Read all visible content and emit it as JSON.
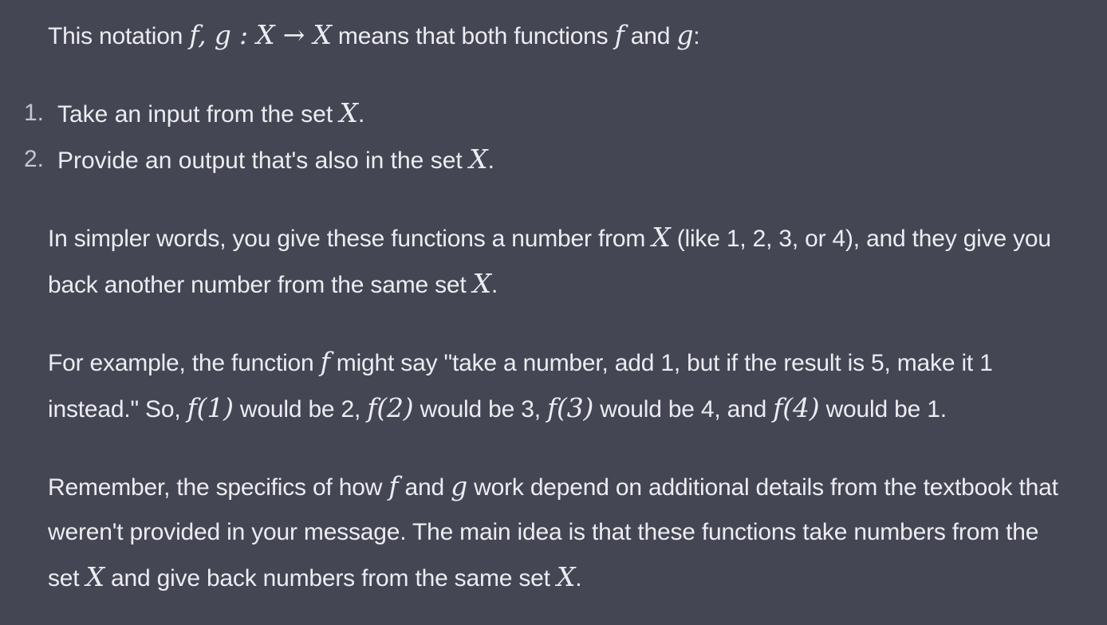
{
  "message": {
    "intro": {
      "t1": "This notation ",
      "m1": "f, g : X → X",
      "t2": " means that both functions ",
      "m2": "f",
      "t3": " and ",
      "m3": "g",
      "t4": ":"
    },
    "list": [
      {
        "num": "1.",
        "text": "Take an input from the set ",
        "math": "X",
        "end": "."
      },
      {
        "num": "2.",
        "text": "Provide an output that's also in the set ",
        "math": "X",
        "end": "."
      }
    ],
    "simpler": {
      "t1": "In simpler words, you give these functions a number from ",
      "m1": "X",
      "t2": " (like 1, 2, 3, or 4), and they give you back another number from the same set ",
      "m2": "X",
      "t3": "."
    },
    "example": {
      "t1": "For example, the function ",
      "m1": "f",
      "t2": " might say \"take a number, add 1, but if the result is 5, make it 1 instead.\" So, ",
      "m2": "f(1)",
      "t3": " would be 2, ",
      "m3": "f(2)",
      "t4": " would be 3, ",
      "m4": "f(3)",
      "t5": " would be 4, and ",
      "m5": "f(4)",
      "t6": " would be 1."
    },
    "remember": {
      "t1": "Remember, the specifics of how ",
      "m1": "f",
      "t2": " and ",
      "m2": "g",
      "t3": " work depend on additional details from the textbook that weren't provided in your message. The main idea is that these functions take numbers from the set ",
      "m3": "X",
      "t4": " and give back numbers from the same set ",
      "m4": "X",
      "t5": "."
    }
  }
}
